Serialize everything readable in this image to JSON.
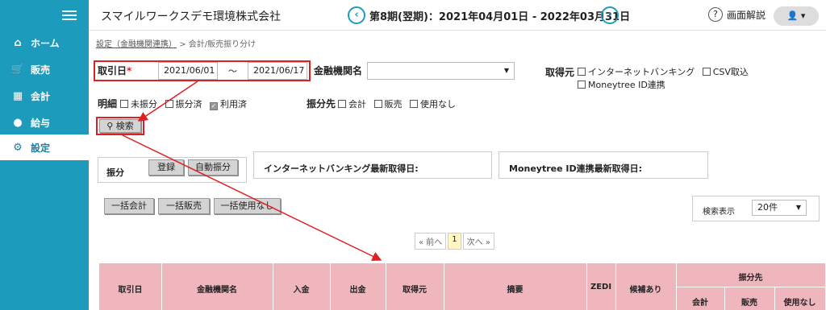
{
  "sidebar": {
    "items": [
      {
        "label": "ホーム",
        "icon": "home-icon"
      },
      {
        "label": "販売",
        "icon": "cart-icon"
      },
      {
        "label": "会計",
        "icon": "calculator-icon"
      },
      {
        "label": "給与",
        "icon": "moneybag-icon"
      },
      {
        "label": "設定",
        "icon": "gear-icon"
      }
    ]
  },
  "header": {
    "company": "スマイルワークスデモ環境株式会社",
    "period": "第8期(翌期)：2021年04月01日 - 2022年03月31日",
    "help": "画面解説"
  },
  "breadcrumb": {
    "link": "設定（金融機関連携）",
    "sep": ">",
    "current": "会計/販売振り分け"
  },
  "filters": {
    "date_label": "取引日",
    "required_mark": "*",
    "date_from": "2021/06/01",
    "tilde": "～",
    "date_to": "2021/06/17",
    "bank_label": "金融機関名",
    "bank_value": "",
    "source_label": "取得元",
    "source_options": [
      "インターネットバンキング",
      "CSV取込",
      "Moneytree ID連携"
    ],
    "detail_label": "明細",
    "detail_options": [
      "未振分",
      "振分済",
      "利用済"
    ],
    "dest_label": "振分先",
    "dest_options": [
      "会計",
      "販売",
      "使用なし"
    ],
    "search_label": "検索"
  },
  "assign": {
    "label": "振分",
    "register": "登録",
    "auto": "自動振分"
  },
  "info": {
    "ib_label": "インターネットバンキング最新取得日:",
    "mt_label": "Moneytree ID連携最新取得日:"
  },
  "bulk": {
    "accounting": "一括会計",
    "sales": "一括販売",
    "unused": "一括使用なし"
  },
  "display": {
    "label": "検索表示",
    "value": "20件"
  },
  "pagination": {
    "prev": "« 前へ",
    "page": "1",
    "next": "次へ »"
  },
  "table": {
    "headers": [
      "取引日",
      "金融機関名",
      "入金",
      "出金",
      "取得元",
      "摘要",
      "ZEDI",
      "候補あり",
      "振分先"
    ],
    "sub_headers": [
      "会計",
      "販売",
      "使用なし"
    ]
  },
  "colors": {
    "sidebar": "#1d9bbd",
    "table_header": "#f0b6be",
    "annotation": "#e02020"
  }
}
